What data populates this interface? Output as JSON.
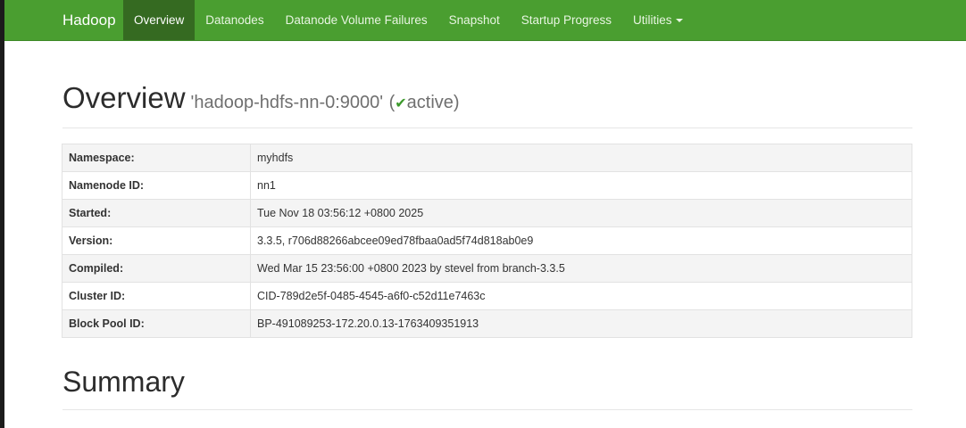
{
  "navbar": {
    "brand": "Hadoop",
    "items": [
      {
        "label": "Overview"
      },
      {
        "label": "Datanodes"
      },
      {
        "label": "Datanode Volume Failures"
      },
      {
        "label": "Snapshot"
      },
      {
        "label": "Startup Progress"
      },
      {
        "label": "Utilities"
      }
    ],
    "active_index": 0
  },
  "overview": {
    "heading": "Overview",
    "host": "'hadoop-hdfs-nn-0:9000'",
    "status_open": "(",
    "status": "active",
    "status_close": ")"
  },
  "info_table": [
    {
      "key": "Namespace:",
      "value": "myhdfs"
    },
    {
      "key": "Namenode ID:",
      "value": "nn1"
    },
    {
      "key": "Started:",
      "value": "Tue Nov 18 03:56:12 +0800 2025"
    },
    {
      "key": "Version:",
      "value": "3.3.5, r706d88266abcee09ed78fbaa0ad5f74d818ab0e9"
    },
    {
      "key": "Compiled:",
      "value": "Wed Mar 15 23:56:00 +0800 2023 by stevel from branch-3.3.5"
    },
    {
      "key": "Cluster ID:",
      "value": "CID-789d2e5f-0485-4545-a6f0-c52d11e7463c"
    },
    {
      "key": "Block Pool ID:",
      "value": "BP-491089253-172.20.0.13-1763409351913"
    }
  ],
  "summary": {
    "heading": "Summary"
  },
  "colors": {
    "navbar": "#4a9e30",
    "active_tab": "#356a21",
    "check": "#3c9a2c"
  },
  "icons": {
    "status": "checkmark-icon",
    "utilities": "caret-down-icon"
  }
}
